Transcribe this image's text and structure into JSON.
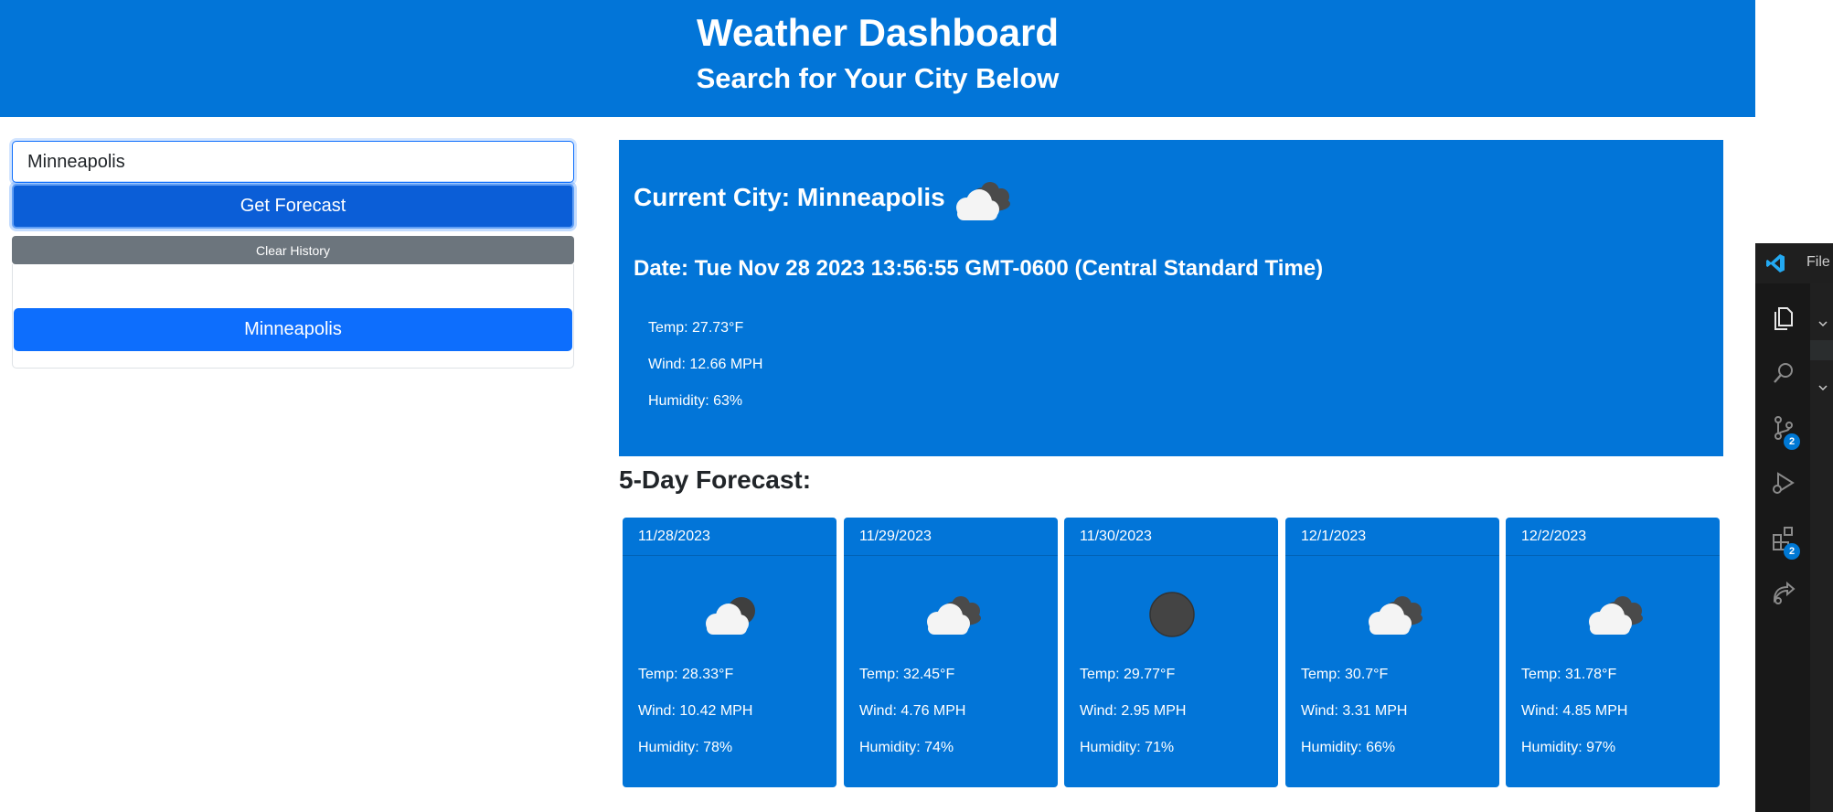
{
  "header": {
    "title": "Weather Dashboard",
    "subtitle": "Search for Your City Below"
  },
  "search": {
    "value": "Minneapolis",
    "button_label": "Get Forecast",
    "clear_label": "Clear History"
  },
  "history": [
    "Minneapolis"
  ],
  "current": {
    "city": "Current City: Minneapolis",
    "icon": "cloud-icon",
    "date": "Date: Tue Nov 28 2023 13:56:55 GMT-0600 (Central Standard Time)",
    "temp": "Temp: 27.73°F",
    "wind": "Wind: 12.66 MPH",
    "humidity": "Humidity: 63%"
  },
  "forecast": {
    "title": "5-Day Forecast:",
    "days": [
      {
        "date": "11/28/2023",
        "icon": "cloud-icon",
        "temp": "Temp: 28.33°F",
        "wind": "Wind: 10.42 MPH",
        "humidity": "Humidity: 78%"
      },
      {
        "date": "11/29/2023",
        "icon": "cloud-icon",
        "temp": "Temp: 32.45°F",
        "wind": "Wind: 4.76 MPH",
        "humidity": "Humidity: 74%"
      },
      {
        "date": "11/30/2023",
        "icon": "dark-circle-icon",
        "temp": "Temp: 29.77°F",
        "wind": "Wind: 2.95 MPH",
        "humidity": "Humidity: 71%"
      },
      {
        "date": "12/1/2023",
        "icon": "cloud-icon",
        "temp": "Temp: 30.7°F",
        "wind": "Wind: 3.31 MPH",
        "humidity": "Humidity: 66%"
      },
      {
        "date": "12/2/2023",
        "icon": "cloud-icon",
        "temp": "Temp: 31.78°F",
        "wind": "Wind: 4.85 MPH",
        "humidity": "Humidity: 97%"
      }
    ]
  },
  "vscode": {
    "menu_file": "File",
    "source_control_badge": "2",
    "extensions_badge": "2"
  },
  "colors": {
    "header_bg": "#0275d8",
    "primary_button": "#0d6efd",
    "secondary_button": "#6c757d",
    "card_bg": "#0275d8"
  }
}
